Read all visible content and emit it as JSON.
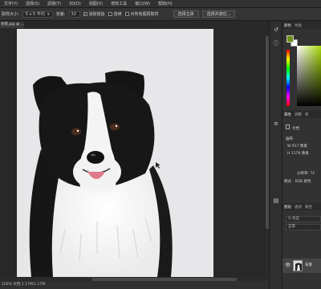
{
  "menu": [
    "文字(Y)",
    "选择(S)",
    "滤镜(T)",
    "3D(D)",
    "视图(V)",
    "增效工具",
    "窗口(W)",
    "帮助(H)"
  ],
  "options": {
    "size_label": "取样大小:",
    "size_value": "5 x 5 平均",
    "tolerance_label": "容差:",
    "tolerance_value": "32",
    "antialias_label": "消除锯齿",
    "antialias_checked": "✓",
    "contiguous_label": "连续",
    "all_layers_label": "对所有图层取样",
    "select_subject_button": "选择主体",
    "select_and_mask_button": "选择并遮住..."
  },
  "document_tab": "背景.jpg @ ...",
  "status_text": "100%   文档:1.17M/1.17M",
  "panels": {
    "color_tabs": [
      "颜色",
      "色板"
    ],
    "colors": {
      "foreground": "#6e8f19",
      "background": "#ffffff"
    },
    "properties_tabs": [
      "属性",
      "调整",
      "库"
    ],
    "properties_title": "文档",
    "canvas_heading": "画布",
    "width_label": "W",
    "width_value": "917 像素",
    "height_label": "H",
    "height_value": "1178 像素",
    "resolution": "分辨率: 72",
    "mode_label": "模式",
    "mode_value": "RGB 颜色",
    "layers_tabs": [
      "图层",
      "通道",
      "路径"
    ],
    "layer_search": "Q 类型",
    "blend_mode": "正常",
    "layer_name": "背景"
  }
}
